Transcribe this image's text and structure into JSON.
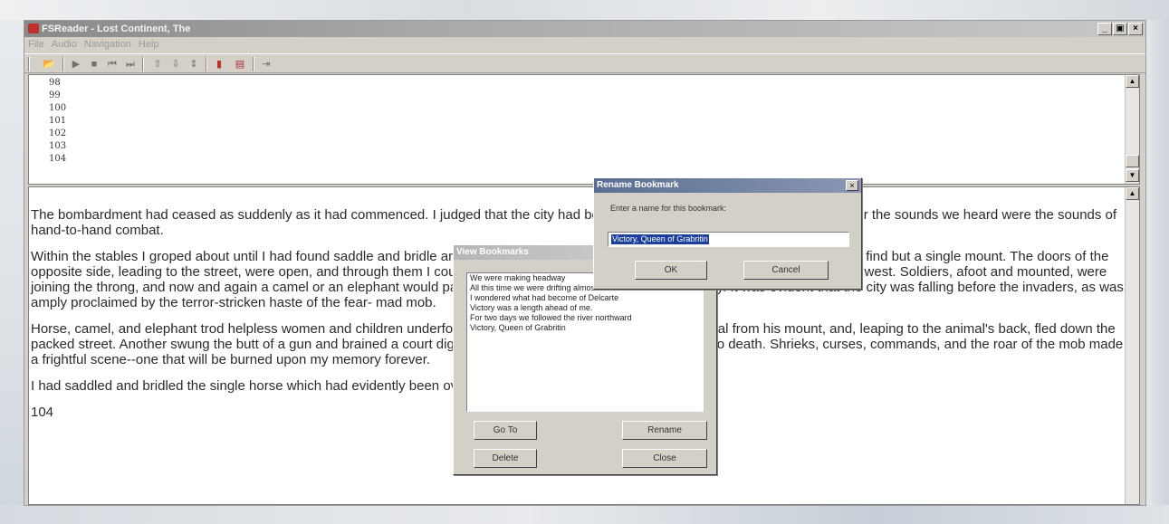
{
  "window": {
    "title": "FSReader - Lost Continent, The",
    "buttons": [
      "_",
      "▣",
      "×"
    ]
  },
  "menu": [
    "File",
    "Audio",
    "Navigation",
    "Help"
  ],
  "toolbar": {
    "icons": [
      "open-folder-icon",
      "play-icon",
      "stop-icon",
      "previous-icon",
      "next-icon",
      "up-arrow-icon",
      "down-arrow-icon",
      "up-down-icon",
      "bookmark-icon",
      "bookmark-list-icon",
      "exit-icon"
    ],
    "glyphs": [
      "📂",
      "▶",
      "■",
      "⏮",
      "⏭",
      "⇧",
      "⇩",
      "⇕",
      "▮",
      "▤",
      "⇥"
    ]
  },
  "top_pane": {
    "pages": [
      "98",
      "99",
      "100",
      "101",
      "102",
      "103",
      "104"
    ]
  },
  "reading_pane": {
    "paragraphs": [
      "The bombardment had ceased as suddenly as it had commenced. I judged that the city had been taken by storm, and with good reason, for the sounds we heard were the sounds of hand-to-hand combat.",
      "Within the stables I groped about until I had found saddle and bridle and then, feeling my way along the stalls in the semi-darkness, I could find but a single mount. The doors of the opposite side, leading to the street, were open, and through them I could see a solid mass of men, women, and children fleeing toward the west. Soldiers, afoot and mounted, were joining the throng, and now and again a camel or an elephant would pass bearing some officer or dignitary to safety. It was evident that the city was falling before the invaders, as was amply proclaimed by the terror-stricken haste of the fear- mad mob.",
      "Horse, camel, and elephant trod helpless women and children underfoot. I saw a common soldier dragged a general from his mount, and, leaping to the animal's back, fled down the packed street. Another swung the butt of a gun and brained a court dignitary, whose horse had trampled her child to death. Shrieks, curses, commands, and the roar of the mob made a frightful scene--one that will be burned upon my memory forever.",
      "I had saddled and bridled the single horse which had evidently been overlooked in the haste.",
      "104"
    ]
  },
  "view_bookmarks": {
    "title": "View Bookmarks",
    "items": [
      "We were making headway",
      "All this time we were drifting almost due east.",
      "I wondered what had become of Delcarte",
      "Victory was a length ahead of me.",
      "For two days we followed the river northward",
      "Victory, Queen of Grabritin"
    ],
    "goto_label": "Go To",
    "rename_label": "Rename",
    "delete_label": "Delete",
    "close_label": "Close"
  },
  "rename_bookmark": {
    "title": "Rename Bookmark",
    "close_glyph": "×",
    "prompt": "Enter a name for this bookmark:",
    "value": "Victory, Queen of Grabritin",
    "ok_label": "OK",
    "cancel_label": "Cancel"
  }
}
